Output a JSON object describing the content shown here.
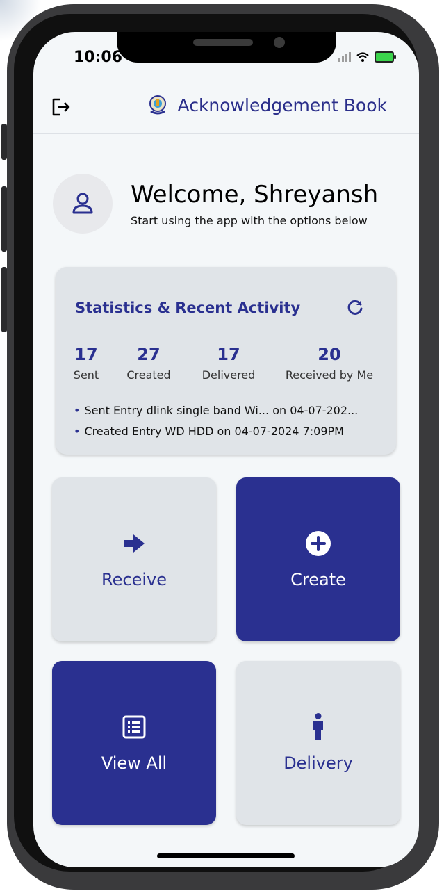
{
  "status_bar": {
    "time": "10:06"
  },
  "app_bar": {
    "title": "Acknowledgement Book",
    "logout_icon": "logout-icon",
    "logo_icon": "emblem-logo"
  },
  "welcome": {
    "title": "Welcome, Shreyansh",
    "subtitle": "Start using the app with the options below",
    "avatar_icon": "user-icon"
  },
  "stats": {
    "title": "Statistics & Recent Activity",
    "refresh_icon": "refresh-icon",
    "items": [
      {
        "value": "17",
        "label": "Sent"
      },
      {
        "value": "27",
        "label": "Created"
      },
      {
        "value": "17",
        "label": "Delivered"
      },
      {
        "value": "20",
        "label": "Received by Me"
      }
    ],
    "activity": [
      "Sent Entry dlink single band Wi... on 04-07-202...",
      "Created Entry WD HDD on 04-07-2024 7:09PM"
    ]
  },
  "actions": {
    "receive": {
      "label": "Receive",
      "icon": "arrow-right-icon"
    },
    "create": {
      "label": "Create",
      "icon": "plus-circle-icon"
    },
    "view_all": {
      "label": "View All",
      "icon": "list-icon"
    },
    "delivery": {
      "label": "Delivery",
      "icon": "person-icon"
    }
  },
  "colors": {
    "primary": "#2a3090",
    "card_bg": "#e0e4e8",
    "screen_bg": "#f4f7f9"
  }
}
